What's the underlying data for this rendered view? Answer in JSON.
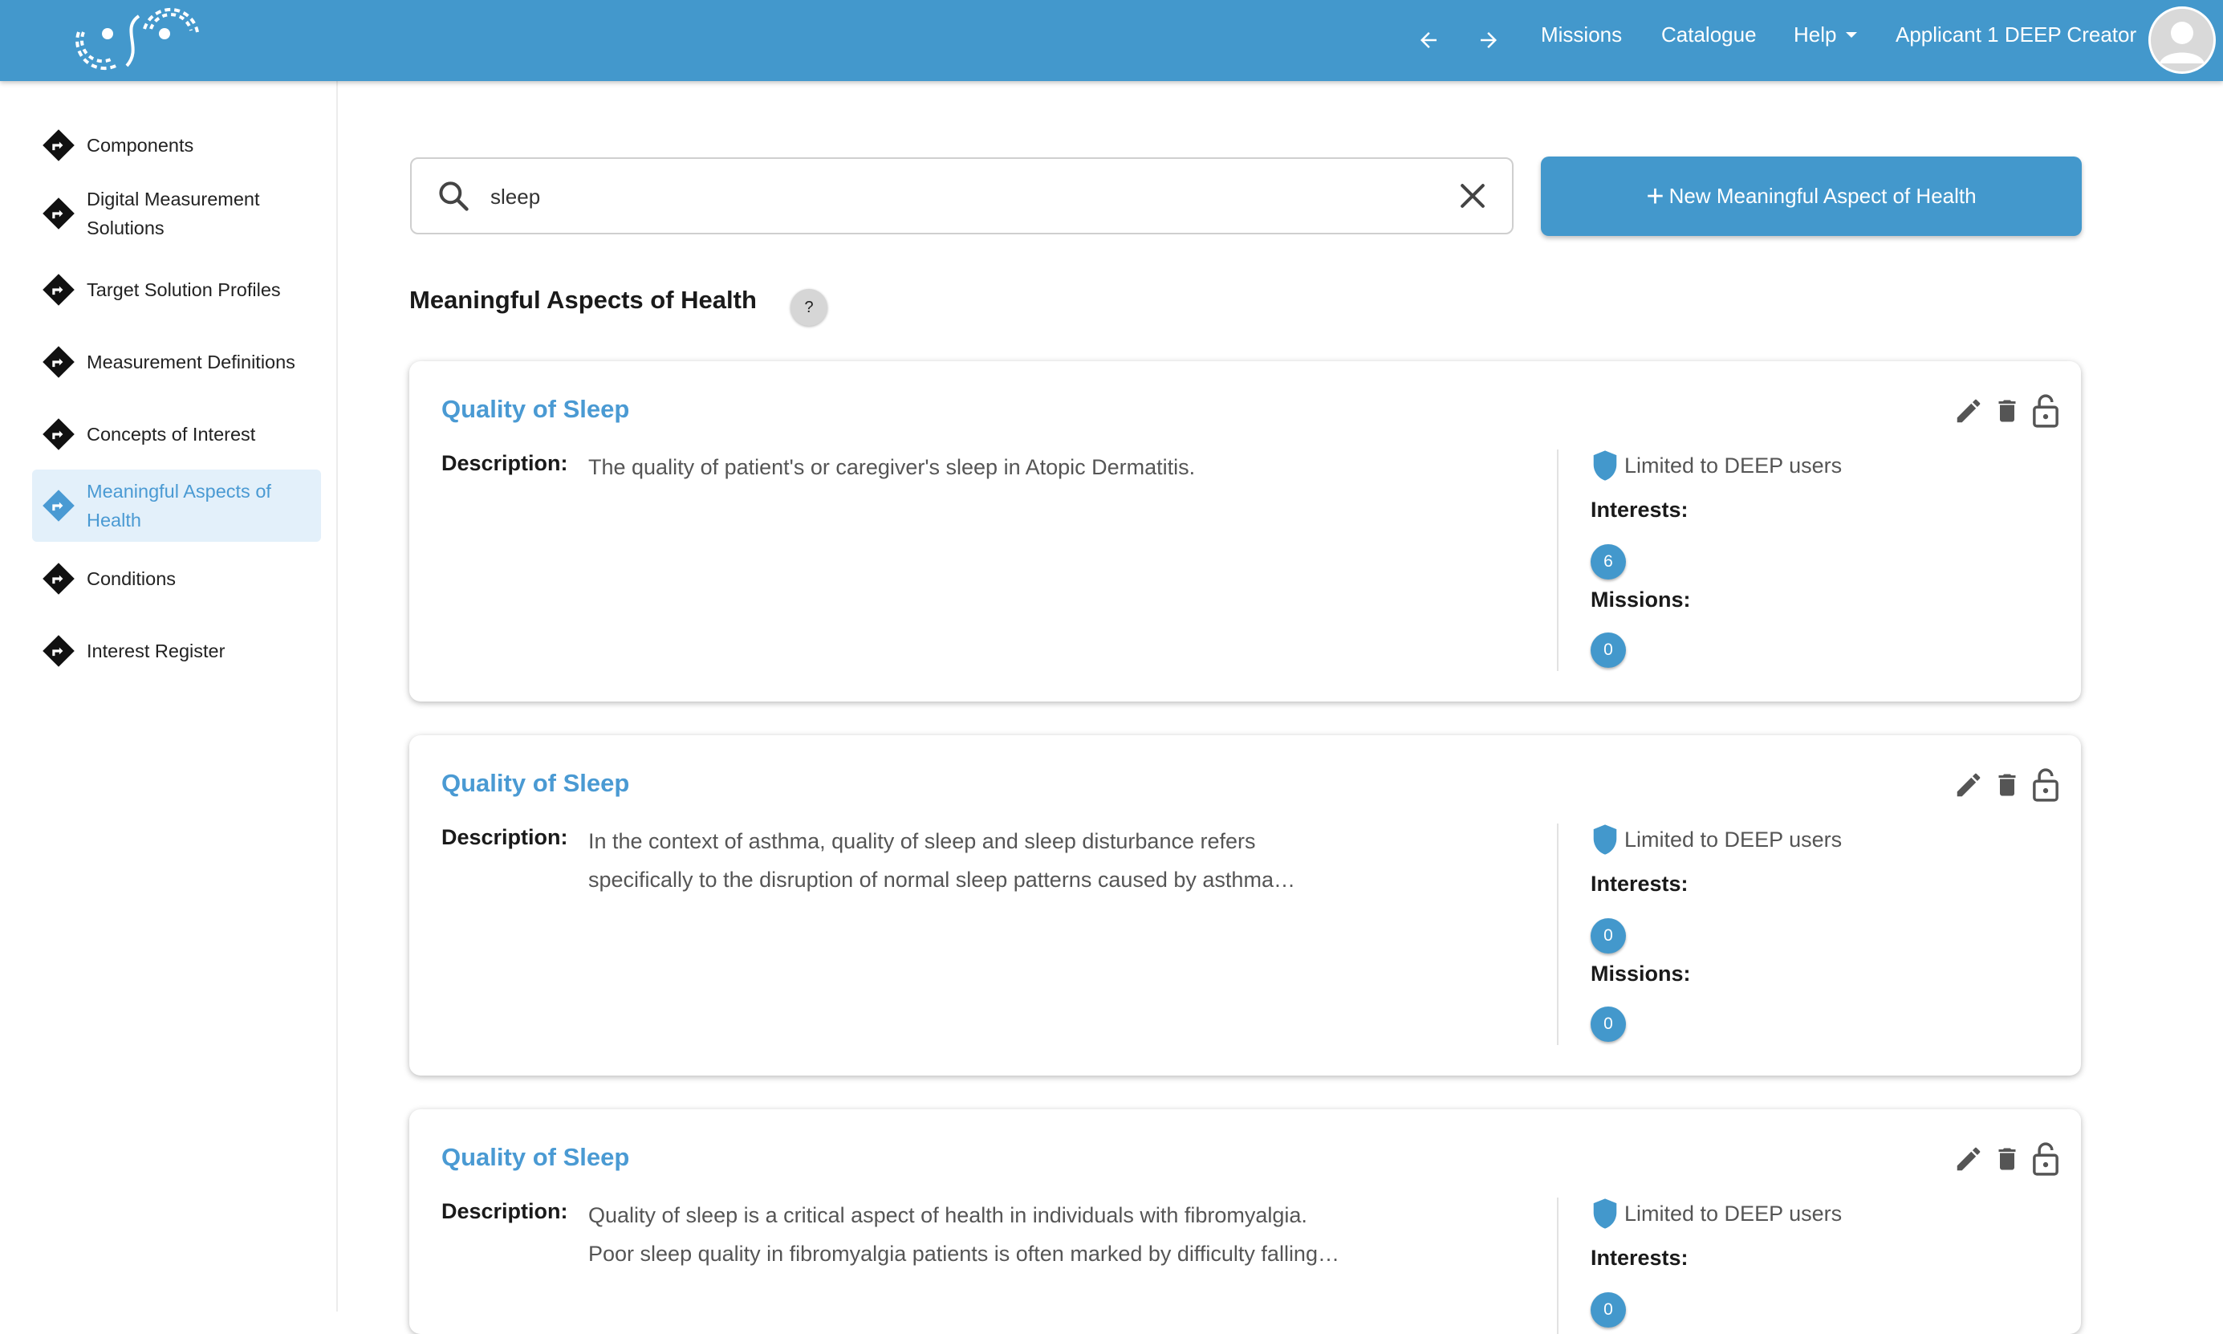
{
  "topbar": {
    "nav_links": [
      "Missions",
      "Catalogue",
      "Help"
    ],
    "user_label": "Applicant 1 DEEP Creator",
    "icons": {
      "back": "arrow-left-icon",
      "forward": "arrow-right-icon",
      "help_menu": "caret-down-icon",
      "avatar": "user-avatar-icon"
    }
  },
  "sidebar": {
    "items": [
      {
        "label": "Components"
      },
      {
        "label": "Digital Measurement Solutions"
      },
      {
        "label": "Target Solution Profiles"
      },
      {
        "label": "Measurement Definitions"
      },
      {
        "label": "Concepts of Interest"
      },
      {
        "label": "Meaningful Aspects of Health",
        "active": true
      },
      {
        "label": "Conditions"
      },
      {
        "label": "Interest Register"
      }
    ],
    "item_icon": "diamond-turn-right-icon"
  },
  "search": {
    "value": "sleep",
    "icon": "search-icon",
    "clear_icon": "close-icon"
  },
  "new_button": {
    "label": "New Meaningful Aspect of Health",
    "icon": "plus-icon"
  },
  "section": {
    "title": "Meaningful Aspects of Health",
    "help_label": "?"
  },
  "card_labels": {
    "description": "Description:",
    "limited": "Limited to DEEP users",
    "interests": "Interests:",
    "missions": "Missions:"
  },
  "cards": [
    {
      "title": "Quality of Sleep",
      "description_lines": [
        "The quality of patient's or caregiver's sleep in Atopic Dermatitis."
      ],
      "interests": "6",
      "missions": "0"
    },
    {
      "title": "Quality of Sleep",
      "description_lines": [
        "In the context of asthma, quality of sleep and sleep disturbance refers",
        "specifically to the disruption of normal sleep patterns caused by asthma…"
      ],
      "interests": "0",
      "missions": "0"
    },
    {
      "title": "Quality of Sleep",
      "description_lines": [
        "Quality of sleep is a critical aspect of health in individuals with fibromyalgia.",
        "Poor sleep quality in fibromyalgia patients is often marked by difficulty falling…"
      ],
      "interests": "0",
      "missions": null
    }
  ],
  "colors": {
    "brand": "#4398cc",
    "link": "#4a9ad3",
    "active_bg": "#e3f0fa"
  }
}
